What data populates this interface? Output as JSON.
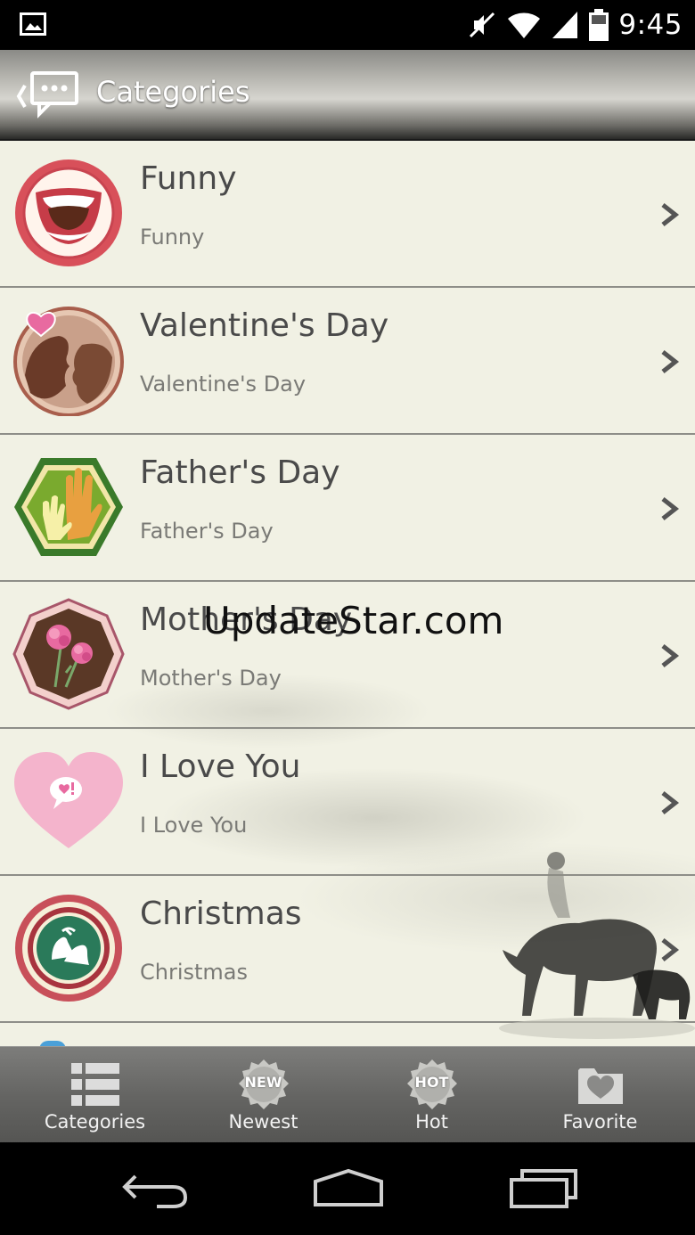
{
  "status_bar": {
    "time": "9:45",
    "icons": [
      "image-notification-icon",
      "mute-icon",
      "wifi-icon",
      "signal-icon",
      "battery-icon"
    ]
  },
  "header": {
    "title": "Categories",
    "back_icon": "back-chat-icon"
  },
  "categories": [
    {
      "title": "Funny",
      "subtitle": "Funny",
      "icon": "laughing-mouth-icon"
    },
    {
      "title": "Valentine's Day",
      "subtitle": "Valentine's Day",
      "icon": "kissing-couple-icon"
    },
    {
      "title": "Father's Day",
      "subtitle": "Father's Day",
      "icon": "hands-icon"
    },
    {
      "title": "Mother's Day",
      "subtitle": "Mother's Day",
      "icon": "carnation-icon"
    },
    {
      "title": "I Love You",
      "subtitle": "I Love You",
      "icon": "heart-speech-icon"
    },
    {
      "title": "Christmas",
      "subtitle": "Christmas",
      "icon": "bells-icon"
    }
  ],
  "watermark": "UpdateStar.com",
  "tabs": [
    {
      "label": "Categories",
      "icon": "list-icon"
    },
    {
      "label": "Newest",
      "icon": "new-badge-icon",
      "badge": "NEW"
    },
    {
      "label": "Hot",
      "icon": "hot-badge-icon",
      "badge": "HOT"
    },
    {
      "label": "Favorite",
      "icon": "favorite-folder-icon"
    }
  ],
  "colors": {
    "list_bg": "#f1f1e4",
    "title_text": "#4a4a4a",
    "subtitle_text": "#7a7a76",
    "funny_red": "#d8505a",
    "valentine_brown": "#8a5a48",
    "father_green": "#6a9a28",
    "mother_pink": "#e86aa0",
    "love_pink": "#f4b4cc",
    "christmas_green": "#2a7a5a"
  }
}
